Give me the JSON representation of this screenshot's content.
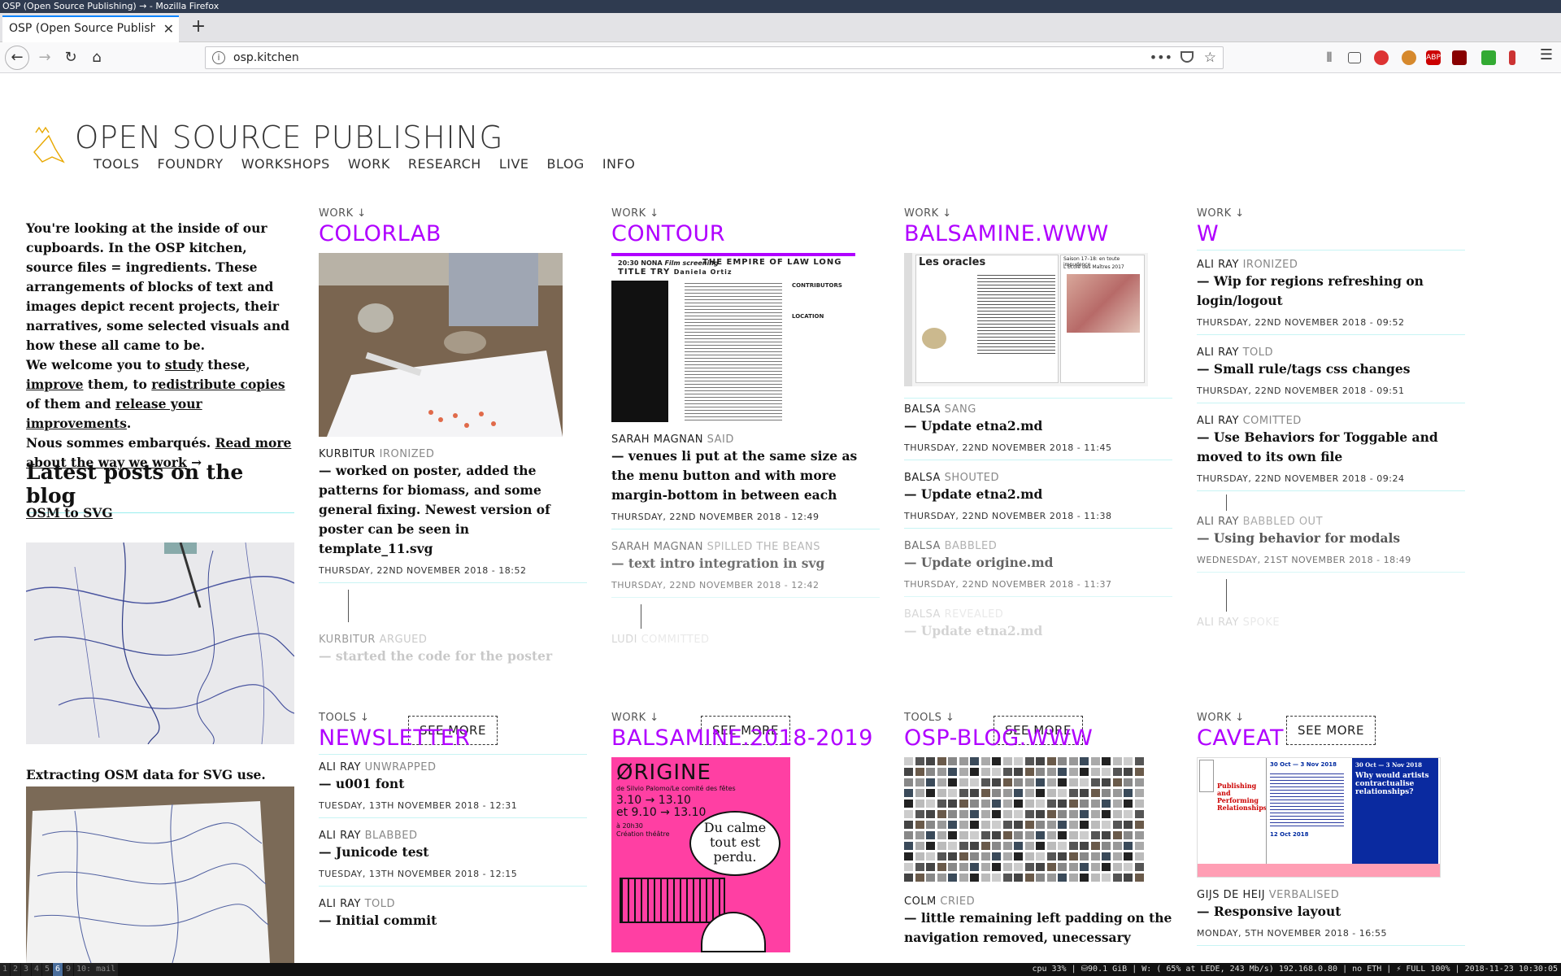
{
  "window": {
    "title": "OSP (Open Source Publishing) → - Mozilla Firefox"
  },
  "tab": {
    "label": "OSP (Open Source Publishing) →"
  },
  "url": "osp.kitchen",
  "site": {
    "title": "OPEN SOURCE PUBLISHING",
    "nav": [
      "TOOLS",
      "FOUNDRY",
      "WORKSHOPS",
      "WORK",
      "RESEARCH",
      "LIVE",
      "BLOG",
      "INFO"
    ]
  },
  "intro": {
    "p1": "You're looking at the inside of our cupboards. In the OSP kitchen, source files = ingredients. These arrangements of blocks of text and images depict recent projects, their narratives, some selected visuals and how these all came to be.",
    "p2a": "We welcome you to",
    "study": "study",
    "p2b": "these,",
    "improve": "improve",
    "p2c": "them, to",
    "redistribute": "redistribute copies",
    "p2d": "of them and",
    "release": "release your improvements",
    "p2e": ".",
    "p3a": "Nous sommes embarqués.",
    "readmore": "Read more about the way we work",
    "arrow": "→"
  },
  "blog": {
    "heading": "Latest posts on the blog",
    "post1": "OSM to SVG",
    "post2": "Extracting OSM data for SVG use."
  },
  "see_more": "SEE MORE",
  "cards": [
    {
      "kicker": "WORK ↓",
      "title": "COLORLAB",
      "entries": [
        {
          "who": "KURBITUR",
          "verb": "IRONIZED",
          "msg": "— worked on poster, added the patterns for biomass, and some general fixing. Newest version of poster can be seen in template_11.svg",
          "date": "THURSDAY, 22ND NOVEMBER 2018 - 18:52"
        },
        {
          "who": "KURBITUR",
          "verb": "ARGUED",
          "msg": "— started the code for the poster",
          "date": ""
        }
      ]
    },
    {
      "kicker": "WORK ↓",
      "title": "CONTOUR",
      "entries": [
        {
          "who": "SARAH MAGNAN",
          "verb": "SAID",
          "msg": "— venues li put at the same size as the menu button and with more margin-bottom in between each",
          "date": "THURSDAY, 22ND NOVEMBER 2018 - 12:49"
        },
        {
          "who": "SARAH MAGNAN",
          "verb": "SPILLED THE BEANS",
          "msg": "— text intro integration in svg",
          "date": "THURSDAY, 22ND NOVEMBER 2018 - 12:42"
        },
        {
          "who": "LUDI",
          "verb": "COMMITTED",
          "msg": "",
          "date": ""
        }
      ]
    },
    {
      "kicker": "WORK ↓",
      "title": "BALSAMINE.WWW",
      "entries": [
        {
          "who": "BALSA",
          "verb": "SANG",
          "msg": "— Update etna2.md",
          "date": "THURSDAY, 22ND NOVEMBER 2018 - 11:45"
        },
        {
          "who": "BALSA",
          "verb": "SHOUTED",
          "msg": "— Update etna2.md",
          "date": "THURSDAY, 22ND NOVEMBER 2018 - 11:38"
        },
        {
          "who": "BALSA",
          "verb": "BABBLED",
          "msg": "— Update origine.md",
          "date": "THURSDAY, 22ND NOVEMBER 2018 - 11:37"
        },
        {
          "who": "BALSA",
          "verb": "REVEALED",
          "msg": "— Update etna2.md",
          "date": ""
        }
      ]
    },
    {
      "kicker": "WORK ↓",
      "title": "W",
      "entries": [
        {
          "who": "ALI RAY",
          "verb": "IRONIZED",
          "msg": "— Wip for regions refreshing on login/logout",
          "date": "THURSDAY, 22ND NOVEMBER 2018 - 09:52"
        },
        {
          "who": "ALI RAY",
          "verb": "TOLD",
          "msg": "— Small rule/tags css changes",
          "date": "THURSDAY, 22ND NOVEMBER 2018 - 09:51"
        },
        {
          "who": "ALI RAY",
          "verb": "COMITTED",
          "msg": "— Use Behaviors for Toggable and moved to its own file",
          "date": "THURSDAY, 22ND NOVEMBER 2018 - 09:24"
        },
        {
          "who": "ALI RAY",
          "verb": "BABBLED OUT",
          "msg": "— Using behavior for modals",
          "date": "WEDNESDAY, 21ST NOVEMBER 2018 - 18:49"
        },
        {
          "who": "ALI RAY",
          "verb": "SPOKE",
          "msg": "",
          "date": ""
        }
      ]
    },
    {
      "kicker": "TOOLS ↓",
      "title": "NEWSLETTER",
      "entries": [
        {
          "who": "ALI RAY",
          "verb": "UNWRAPPED",
          "msg": "— u001 font",
          "date": "TUESDAY, 13TH NOVEMBER 2018 - 12:31"
        },
        {
          "who": "ALI RAY",
          "verb": "BLABBED",
          "msg": "— Junicode test",
          "date": "TUESDAY, 13TH NOVEMBER 2018 - 12:15"
        },
        {
          "who": "ALI RAY",
          "verb": "TOLD",
          "msg": "— Initial commit",
          "date": ""
        }
      ]
    },
    {
      "kicker": "WORK ↓",
      "title": "BALSAMINE.2018-2019",
      "poster": {
        "title": "ØRIGINE",
        "sub": "de Silvio Palomo/Le comité des fêtes",
        "dates1": "3.10 → 13.10",
        "dates2": "et 9.10 → 13.10",
        "time": "à 20h30",
        "kind": "Création théâtre",
        "bubble": "Du calme tout est perdu."
      }
    },
    {
      "kicker": "TOOLS ↓",
      "title": "OSP-BLOG.WWW",
      "entries": [
        {
          "who": "COLM",
          "verb": "CRIED",
          "msg": "— little remaining left padding on the navigation removed, unecessary",
          "date": ""
        }
      ]
    },
    {
      "kicker": "WORK ↓",
      "title": "CAVEAT",
      "entries": [
        {
          "who": "GIJS DE HEIJ",
          "verb": "VERBALISED",
          "msg": "— Responsive layout",
          "date": "MONDAY, 5TH NOVEMBER 2018 - 16:55"
        }
      ]
    }
  ],
  "contour_doc": {
    "hdr1": "20:30 NONA",
    "hdr2": "Film screening",
    "hdr3": "THE EMPIRE OF LAW LONG",
    "hdr4": "TITLE TRY",
    "hdr5": "Daniela Ortiz",
    "contributors": "CONTRIBUTORS",
    "location": "LOCATION"
  },
  "balsamine_doc": {
    "left": "Les oracles",
    "right": "Saison 17–18: en toute impudence",
    "mid": "L'Ecole des Maîtres 2017"
  },
  "caveat_doc": {
    "title": "Publishing and Performing Relationships",
    "date1": "30 Oct — 3 Nov 2018",
    "date2": "30 Oct — 3 Nov 2018",
    "q": "Why would artists contractualise relationships?",
    "date3": "12 Oct 2018"
  },
  "statusbar": {
    "workspaces": [
      "1",
      "2",
      "3",
      "4",
      "5",
      "6",
      "9",
      "10: mail"
    ],
    "active": "6",
    "sys": "cpu  33%  | ⛁90.1 GiB | W: ( 65% at LEDE, 243 Mb/s) 192.168.0.80 | no ETH | ⚡ FULL 100% | 2018-11-23 10:30:05"
  },
  "colors": {
    "accent": "#b000ff",
    "rule": "#9eeeee",
    "titlebar": "#2f3b50"
  }
}
